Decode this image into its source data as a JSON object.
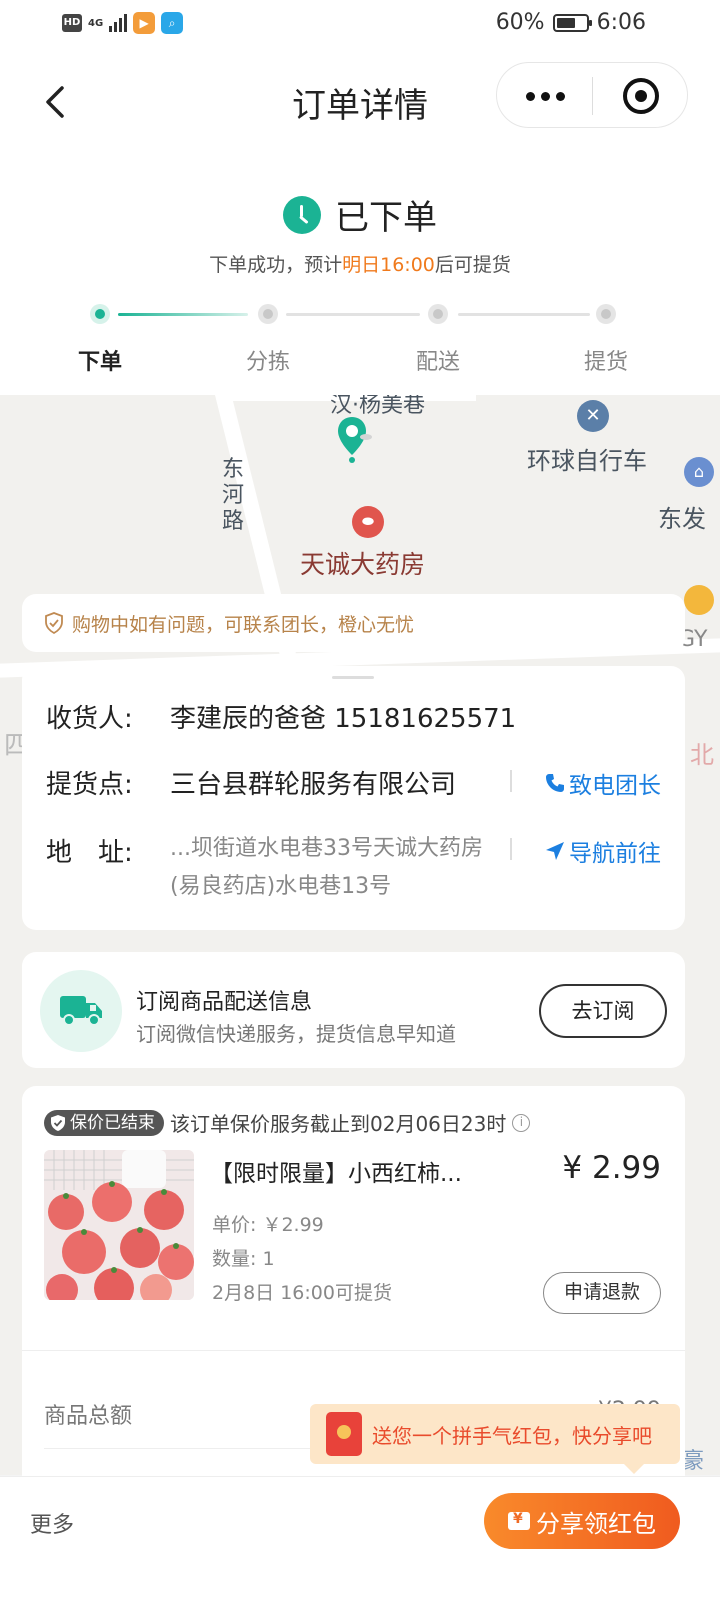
{
  "status_bar": {
    "hd": "HD",
    "network": "4G",
    "battery": "60%",
    "time": "6:06"
  },
  "nav": {
    "title": "订单详情",
    "back_icon": "chevron-left-icon",
    "more_icon": "more-dots-icon",
    "close_icon": "target-close-icon"
  },
  "status": {
    "title": "已下单",
    "subtitle_prefix": "下单成功，预计",
    "subtitle_highlight": "明日16:00",
    "subtitle_suffix": "后可提货",
    "steps": [
      {
        "label": "下单",
        "active": true
      },
      {
        "label": "分拣",
        "active": false
      },
      {
        "label": "配送",
        "active": false
      },
      {
        "label": "提货",
        "active": false
      }
    ],
    "accent_color": "#1bb394",
    "highlight_color": "#f07a1c"
  },
  "map": {
    "labels": {
      "top_partial": "汉·杨美巷",
      "road": "东河路",
      "bike_shop": "环球自行车",
      "pharmacy": "天诚大药房",
      "edge_right": "东发",
      "edge_right2": "GY",
      "edge_left": "四",
      "edge_right3": "北",
      "edge_bottom_right": "豪"
    }
  },
  "notice": {
    "text": "购物中如有问题，可联系团长，橙心无忧"
  },
  "pickup": {
    "receiver_label": "收货人:",
    "receiver_value": "李建辰的爸爸 15181625571",
    "point_label": "提货点:",
    "point_value": "三台县群轮服务有限公司",
    "call_label": "致电团长",
    "address_label": "地　址:",
    "address_value": "...坝街道水电巷33号天诚大药房(易良药店)水电巷13号",
    "nav_label": "导航前往"
  },
  "subscribe": {
    "title": "订阅商品配送信息",
    "desc": "订阅微信快递服务，提货信息早知道",
    "button": "去订阅"
  },
  "order": {
    "guarantee_badge": "保价已结束",
    "guarantee_text": "该订单保价服务截止到02月06日23时",
    "product": {
      "name": "【限时限量】小西红柿...",
      "price": "¥ 2.99",
      "unit_price": "单价: ￥2.99",
      "quantity": "数量: 1",
      "pickup_time": "2月8日 16:00可提货",
      "refund_button": "申请退款"
    },
    "total_label": "商品总额",
    "total_value": "¥2.99"
  },
  "toast": {
    "text": "送您一个拼手气红包，快分享吧"
  },
  "bottom": {
    "more": "更多",
    "share_button": "分享领红包",
    "share_color": "#f05b1f"
  }
}
